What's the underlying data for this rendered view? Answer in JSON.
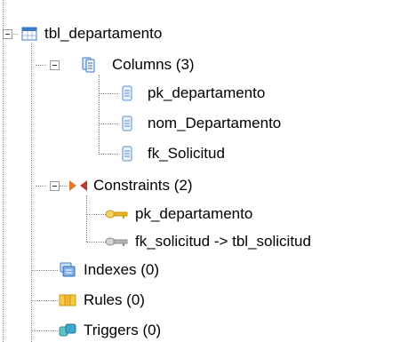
{
  "tree": {
    "table_node": {
      "label": "tbl_departamento",
      "icon": "table-icon"
    },
    "columns_group": {
      "label": "Columns (3)",
      "icon": "columns-icon"
    },
    "columns": [
      {
        "label": "pk_departamento",
        "icon": "column-icon"
      },
      {
        "label": "nom_Departamento",
        "icon": "column-icon"
      },
      {
        "label": "fk_Solicitud",
        "icon": "column-icon"
      }
    ],
    "constraints_group": {
      "label": "Constraints (2)",
      "icon": "constraints-icon"
    },
    "constraints": [
      {
        "label": "pk_departamento",
        "icon": "primary-key-icon"
      },
      {
        "label": "fk_solicitud -> tbl_solicitud",
        "icon": "foreign-key-icon"
      }
    ],
    "indexes": {
      "label": "Indexes (0)",
      "icon": "indexes-icon"
    },
    "rules": {
      "label": "Rules (0)",
      "icon": "rules-icon"
    },
    "triggers": {
      "label": "Triggers (0)",
      "icon": "triggers-icon"
    }
  },
  "colors": {
    "connector": "#8a8a8a",
    "column_icon": "#5b8fd1",
    "key_gold": "#e6b422",
    "key_gray": "#a0a0a0",
    "constraint_orange": "#e0772a",
    "constraint_red": "#c0392b"
  }
}
